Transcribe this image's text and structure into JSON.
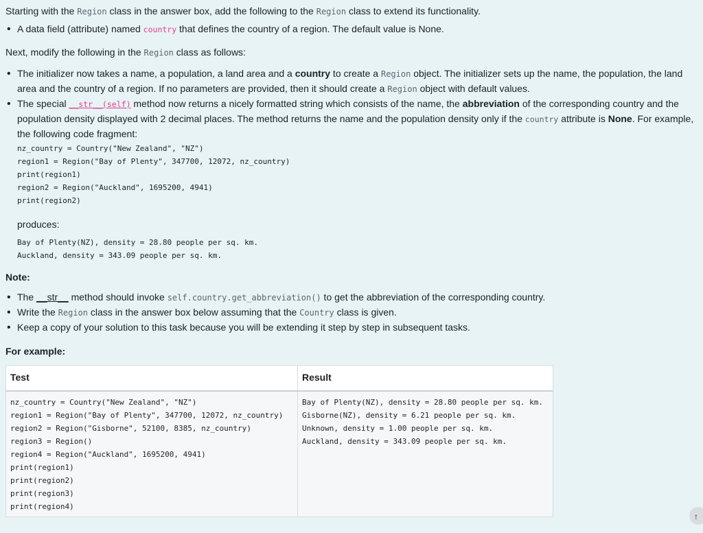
{
  "intro": {
    "p1_a": "Starting with the ",
    "p1_code1": "Region",
    "p1_b": " class in the answer box, add the following to the ",
    "p1_code2": "Region",
    "p1_c": " class to extend its functionality.",
    "bullet1_a": "A data field (attribute) named ",
    "bullet1_code": "country",
    "bullet1_b": " that defines the country of a region. The default value is None."
  },
  "modify": {
    "p_a": "Next, modify the following in the ",
    "p_code": "Region",
    "p_b": " class as follows:",
    "b1_a": "The initializer now takes a name, a population, a land area and a ",
    "b1_bold": "country",
    "b1_b": " to create a ",
    "b1_code": "Region",
    "b1_c": " object. The initializer sets up the name, the population, the land area and the country of a region. If no parameters are provided, then it should create a ",
    "b1_code2": "Region",
    "b1_d": " object with default values.",
    "b2_a": "The special ",
    "b2_code": "__str__(self)",
    "b2_b": " method now returns a nicely formatted string which consists of the name, the ",
    "b2_bold": "abbreviation",
    "b2_c": " of the corresponding country and the population density displayed with 2 decimal places. The method returns the name and the population density only if the ",
    "b2_code2": "country",
    "b2_d": " attribute is ",
    "b2_bold2": "None",
    "b2_e": ". For example, the following code fragment:",
    "code_lines": [
      "nz_country = Country(\"New Zealand\", \"NZ\")",
      "region1 = Region(\"Bay of Plenty\", 347700, 12072, nz_country)",
      "print(region1)",
      "region2 = Region(\"Auckland\", 1695200, 4941)",
      "print(region2)"
    ],
    "produces": "produces:",
    "output_lines": [
      "Bay of Plenty(NZ), density = 28.80 people per sq. km.",
      "Auckland, density = 343.09 people per sq. km."
    ]
  },
  "note": {
    "title": "Note:",
    "n1_a": "The ",
    "n1_code": "__str__",
    "n1_b": " method should invoke ",
    "n1_code2": "self.country.get_abbreviation()",
    "n1_c": " to get the abbreviation of the corresponding country.",
    "n2_a": "Write the ",
    "n2_code": "Region",
    "n2_b": " class in the answer box below assuming that the ",
    "n2_code2": "Country",
    "n2_c": " class is given.",
    "n3": "Keep a copy of your solution to this task because you will be extending it step by step in subsequent tasks."
  },
  "example": {
    "title": "For example:",
    "col_test": "Test",
    "col_result": "Result",
    "test_lines": [
      "nz_country = Country(\"New Zealand\", \"NZ\")",
      "region1 = Region(\"Bay of Plenty\", 347700, 12072, nz_country)",
      "region2 = Region(\"Gisborne\", 52100, 8385, nz_country)",
      "region3 = Region()",
      "region4 = Region(\"Auckland\", 1695200, 4941)",
      "print(region1)",
      "print(region2)",
      "print(region3)",
      "print(region4)"
    ],
    "result_lines": [
      "Bay of Plenty(NZ), density = 28.80 people per sq. km.",
      "Gisborne(NZ), density = 6.21 people per sq. km.",
      "Unknown, density = 1.00 people per sq. km.",
      "Auckland, density = 343.09 people per sq. km."
    ]
  }
}
